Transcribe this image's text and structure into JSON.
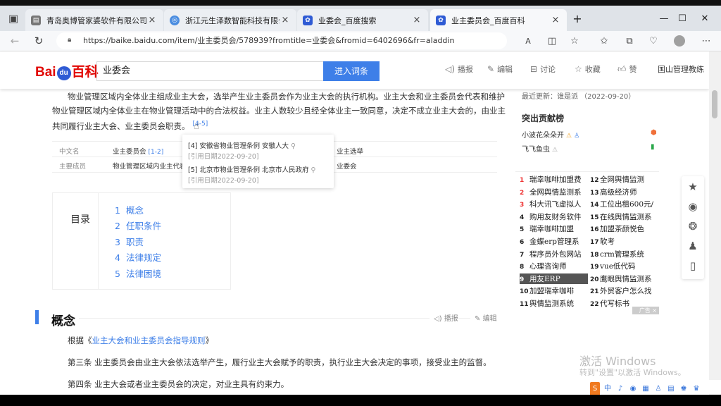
{
  "tabs": [
    {
      "title": "青岛奥博管家婆软件有限公司",
      "close": "×"
    },
    {
      "title": "浙江元生泽数智能科技有限公司",
      "close": "×"
    },
    {
      "title": "业委会_百度搜索",
      "close": "×"
    },
    {
      "title": "业主委员会_百度百科",
      "close": "×"
    }
  ],
  "new_tab": "+",
  "window": {
    "min": "—",
    "max": "☐",
    "close": "✕"
  },
  "address": {
    "url": "https://baike.baidu.com/item/业主委员会/578939?fromtitle=业委会&fromid=6402696&fr=aladdin"
  },
  "header": {
    "logo_left": "Bai",
    "logo_paw": "du",
    "logo_right": "百科",
    "search_value": "业委会",
    "search_button": "进入词条",
    "actions": [
      "播报",
      "编辑",
      "讨论",
      "收藏",
      "赞"
    ],
    "user": "国山管理教练"
  },
  "intro": {
    "line1": "物业管理区域内全体业主组成业主大会，选举产生业主委员会作为业主大会的执行机构。业主大会和业主委员会代表和维护",
    "line2": "物业管理区域内全体业主在物业管理活动中的合法权益。业主人数较少且经全体业主一致同意，决定不成立业主大会的，由业主",
    "line3": "共同履行业主大会、业主委员会职责。",
    "ref": "[4-5]"
  },
  "infobox": {
    "k1": "中文名",
    "v1": "业主委员会",
    "v1_ref": "[1-2]",
    "v1_right": "业主选举",
    "k2": "主要成员",
    "v2": "物业管理区域内业主代表",
    "v2_right": "业委会"
  },
  "tooltip": {
    "ref4": "[4] 安徽省物业管理条例 安徽人大",
    "ref4_date": "[引用日期2022-09-20]",
    "ref5": "[5] 北京市物业管理条例 北京市人民政府",
    "ref5_date": "[引用日期2022-09-20]"
  },
  "toc": {
    "title": "目录",
    "items": [
      {
        "n": "1",
        "label": "概念"
      },
      {
        "n": "2",
        "label": "任职条件"
      },
      {
        "n": "3",
        "label": "职责"
      },
      {
        "n": "4",
        "label": "法律规定"
      },
      {
        "n": "5",
        "label": "法律困境"
      }
    ]
  },
  "section": {
    "title": "概念",
    "play": "播报",
    "edit": "编辑",
    "p1_prefix": "根据《",
    "p1_link": "业主大会和业主委员会指导规则",
    "p1_suffix": "》",
    "p2": "第三条    业主委员会由业主大会依法选举产生，履行业主大会赋予的职责，执行业主大会决定的事项，接受业主的监督。",
    "p3": "第四条    业主大会或者业主委员会的决定，对业主具有约束力。"
  },
  "sidebar": {
    "updated": "最近更新：谁是派  （2022-09-20）",
    "contrib_title": "突出贡献榜",
    "contributors": [
      "小波花朵朵开",
      "飞飞鱼虫"
    ],
    "hot_left": [
      {
        "n": "1",
        "t": "瑞幸咖啡加盟费"
      },
      {
        "n": "2",
        "t": "全网舆情监测系"
      },
      {
        "n": "3",
        "t": "科大讯飞虚拟人"
      },
      {
        "n": "4",
        "t": "购用友财务软件"
      },
      {
        "n": "5",
        "t": "瑞幸咖啡加盟"
      },
      {
        "n": "6",
        "t": "金蝶erp管理系"
      },
      {
        "n": "7",
        "t": "程序员外包网站"
      },
      {
        "n": "8",
        "t": "心理咨询师"
      },
      {
        "n": "9",
        "t": "用友ERP"
      },
      {
        "n": "10",
        "t": "加盟瑞幸咖啡"
      },
      {
        "n": "11",
        "t": "舆情监测系统"
      }
    ],
    "hot_right": [
      {
        "n": "12",
        "t": "全网舆情监测"
      },
      {
        "n": "13",
        "t": "高级经济师"
      },
      {
        "n": "14",
        "t": "工位出租600元/"
      },
      {
        "n": "15",
        "t": "在线舆情监测系"
      },
      {
        "n": "16",
        "t": "加盟茶颜悦色"
      },
      {
        "n": "17",
        "t": "软考"
      },
      {
        "n": "18",
        "t": "crm管理系统"
      },
      {
        "n": "19",
        "t": "vue低代码"
      },
      {
        "n": "20",
        "t": "鹰眼舆情监测系"
      },
      {
        "n": "21",
        "t": "外贸客户怎么找"
      },
      {
        "n": "22",
        "t": "代写标书"
      }
    ],
    "ad": "广告 ×"
  },
  "watermark": {
    "line1": "激活 Windows",
    "line2": "转到\"设置\"以激活 Windows。"
  },
  "tray": [
    "中",
    "♪",
    "◉",
    "▦",
    "♙",
    "▤",
    "♚",
    "♛"
  ]
}
